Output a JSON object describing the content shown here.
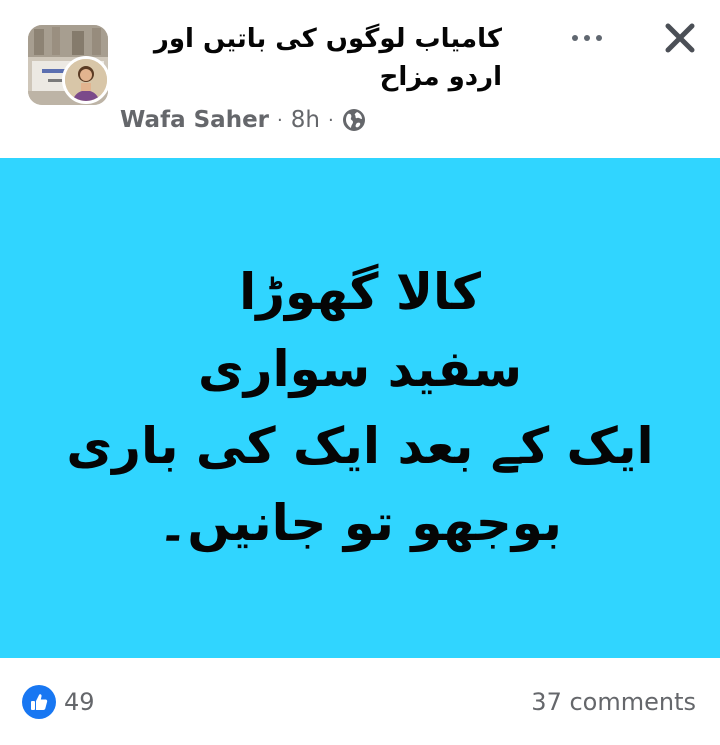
{
  "post": {
    "group_name": "کامیاب لوگوں کی باتیں اور اردو مزاح",
    "author": "Wafa Saher",
    "time": "8h",
    "separator": "·",
    "privacy_icon": "globe-icon",
    "more_icon": "more-options-icon",
    "close_icon": "close-icon"
  },
  "poster": {
    "background": "#30d5ff",
    "lines": [
      "کالا گھوڑا",
      "سفید سواری",
      "ایک کے بعد ایک کی باری",
      "بوجھو تو جانیں۔"
    ]
  },
  "footer": {
    "like_count": "49",
    "comments": "37 comments",
    "like_icon": "thumbs-up-icon",
    "accent": "#1877f2"
  }
}
